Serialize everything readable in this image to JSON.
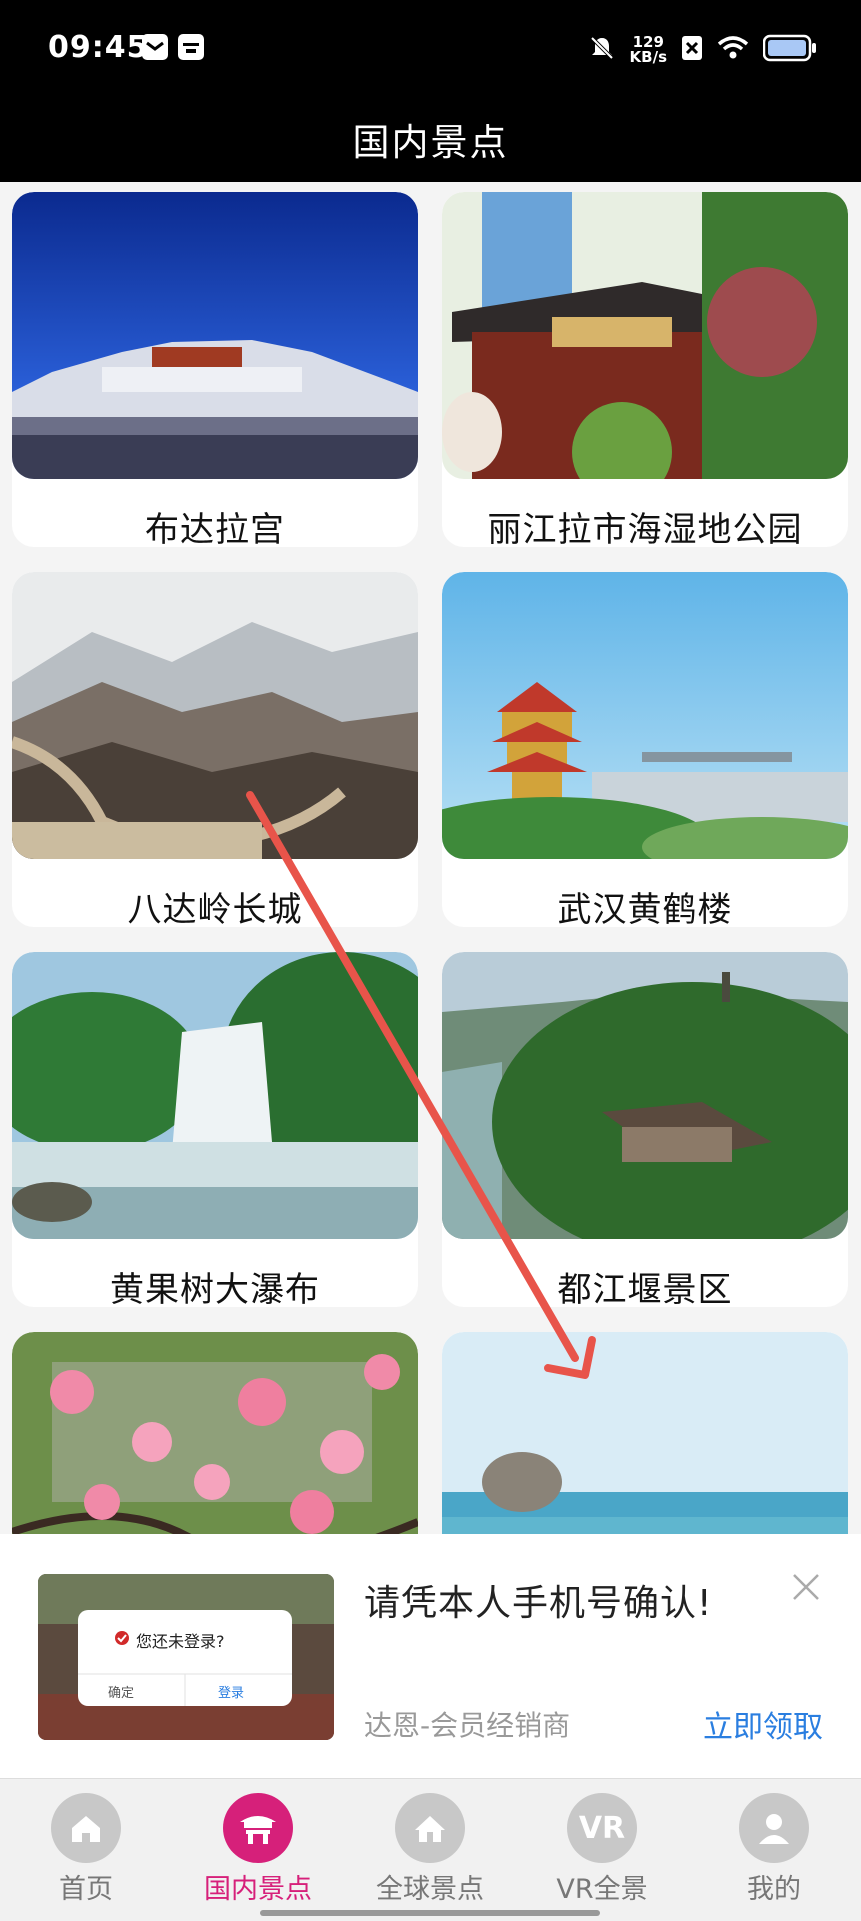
{
  "status_bar": {
    "time": "09:45",
    "net_speed_value": "129",
    "net_speed_unit": "KB/s",
    "icons": [
      "mail-icon",
      "calendar-icon",
      "mute-icon",
      "sim-off-icon",
      "wifi-icon",
      "battery-icon"
    ]
  },
  "header": {
    "title": "国内景点"
  },
  "attractions": [
    {
      "name": "布达拉宫"
    },
    {
      "name": "丽江拉市海湿地公园"
    },
    {
      "name": "八达岭长城"
    },
    {
      "name": "武汉黄鹤楼"
    },
    {
      "name": "黄果树大瀑布"
    },
    {
      "name": "都江堰景区"
    }
  ],
  "ad": {
    "title": "请凭本人手机号确认!",
    "source": "达恩-会员经销商",
    "cta": "立即领取",
    "thumb_dialog": {
      "message": "您还未登录?",
      "confirm": "确定",
      "login": "登录"
    }
  },
  "tab_bar": {
    "tabs": [
      {
        "label": "首页",
        "icon": "home-icon",
        "active": false
      },
      {
        "label": "国内景点",
        "icon": "pavilion-icon",
        "active": true
      },
      {
        "label": "全球景点",
        "icon": "house-icon",
        "active": false
      },
      {
        "label": "VR全景",
        "icon": "vr-icon",
        "icon_text": "VR",
        "active": false
      },
      {
        "label": "我的",
        "icon": "user-icon",
        "active": false
      }
    ]
  },
  "colors": {
    "accent": "#d6207a",
    "link": "#2a7ee0",
    "header_bg": "#000000"
  }
}
